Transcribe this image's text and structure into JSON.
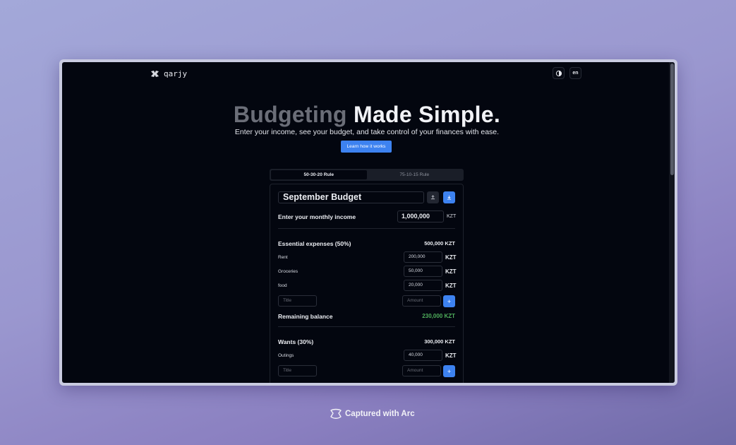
{
  "header": {
    "logo_text": "qarjy",
    "theme_toggle_icon": "theme-toggle-icon",
    "language_label": "en"
  },
  "hero": {
    "title_muted": "Budgeting",
    "title_bright": "Made Simple.",
    "subtitle": "Enter your income, see your budget, and take control of your finances with ease.",
    "cta_label": "Learn how it works"
  },
  "tabs": [
    {
      "label": "50-30-20 Rule",
      "active": true
    },
    {
      "label": "75-10-15 Rule",
      "active": false
    }
  ],
  "budget": {
    "title": "September Budget",
    "income_label": "Enter your monthly income",
    "income_value": "1,000,000",
    "currency": "KZT",
    "essential": {
      "title": "Essential expenses (50%)",
      "total": "500,000 KZT",
      "items": [
        {
          "label": "Rent",
          "value": "200,000"
        },
        {
          "label": "Groceries",
          "value": "50,000"
        },
        {
          "label": "food",
          "value": "20,000"
        }
      ],
      "title_placeholder": "Title",
      "amount_placeholder": "Amount"
    },
    "remaining": {
      "label": "Remaining balance",
      "value": "230,000 KZT"
    },
    "wants": {
      "title": "Wants (30%)",
      "total": "300,000 KZT",
      "items": [
        {
          "label": "Outings",
          "value": "40,000"
        }
      ],
      "title_placeholder": "Title",
      "amount_placeholder": "Amount"
    }
  },
  "footer": {
    "caption": "Captured with Arc"
  },
  "colors": {
    "accent": "#3d82f0",
    "background": "#03060f",
    "positive": "#4fae5c"
  }
}
